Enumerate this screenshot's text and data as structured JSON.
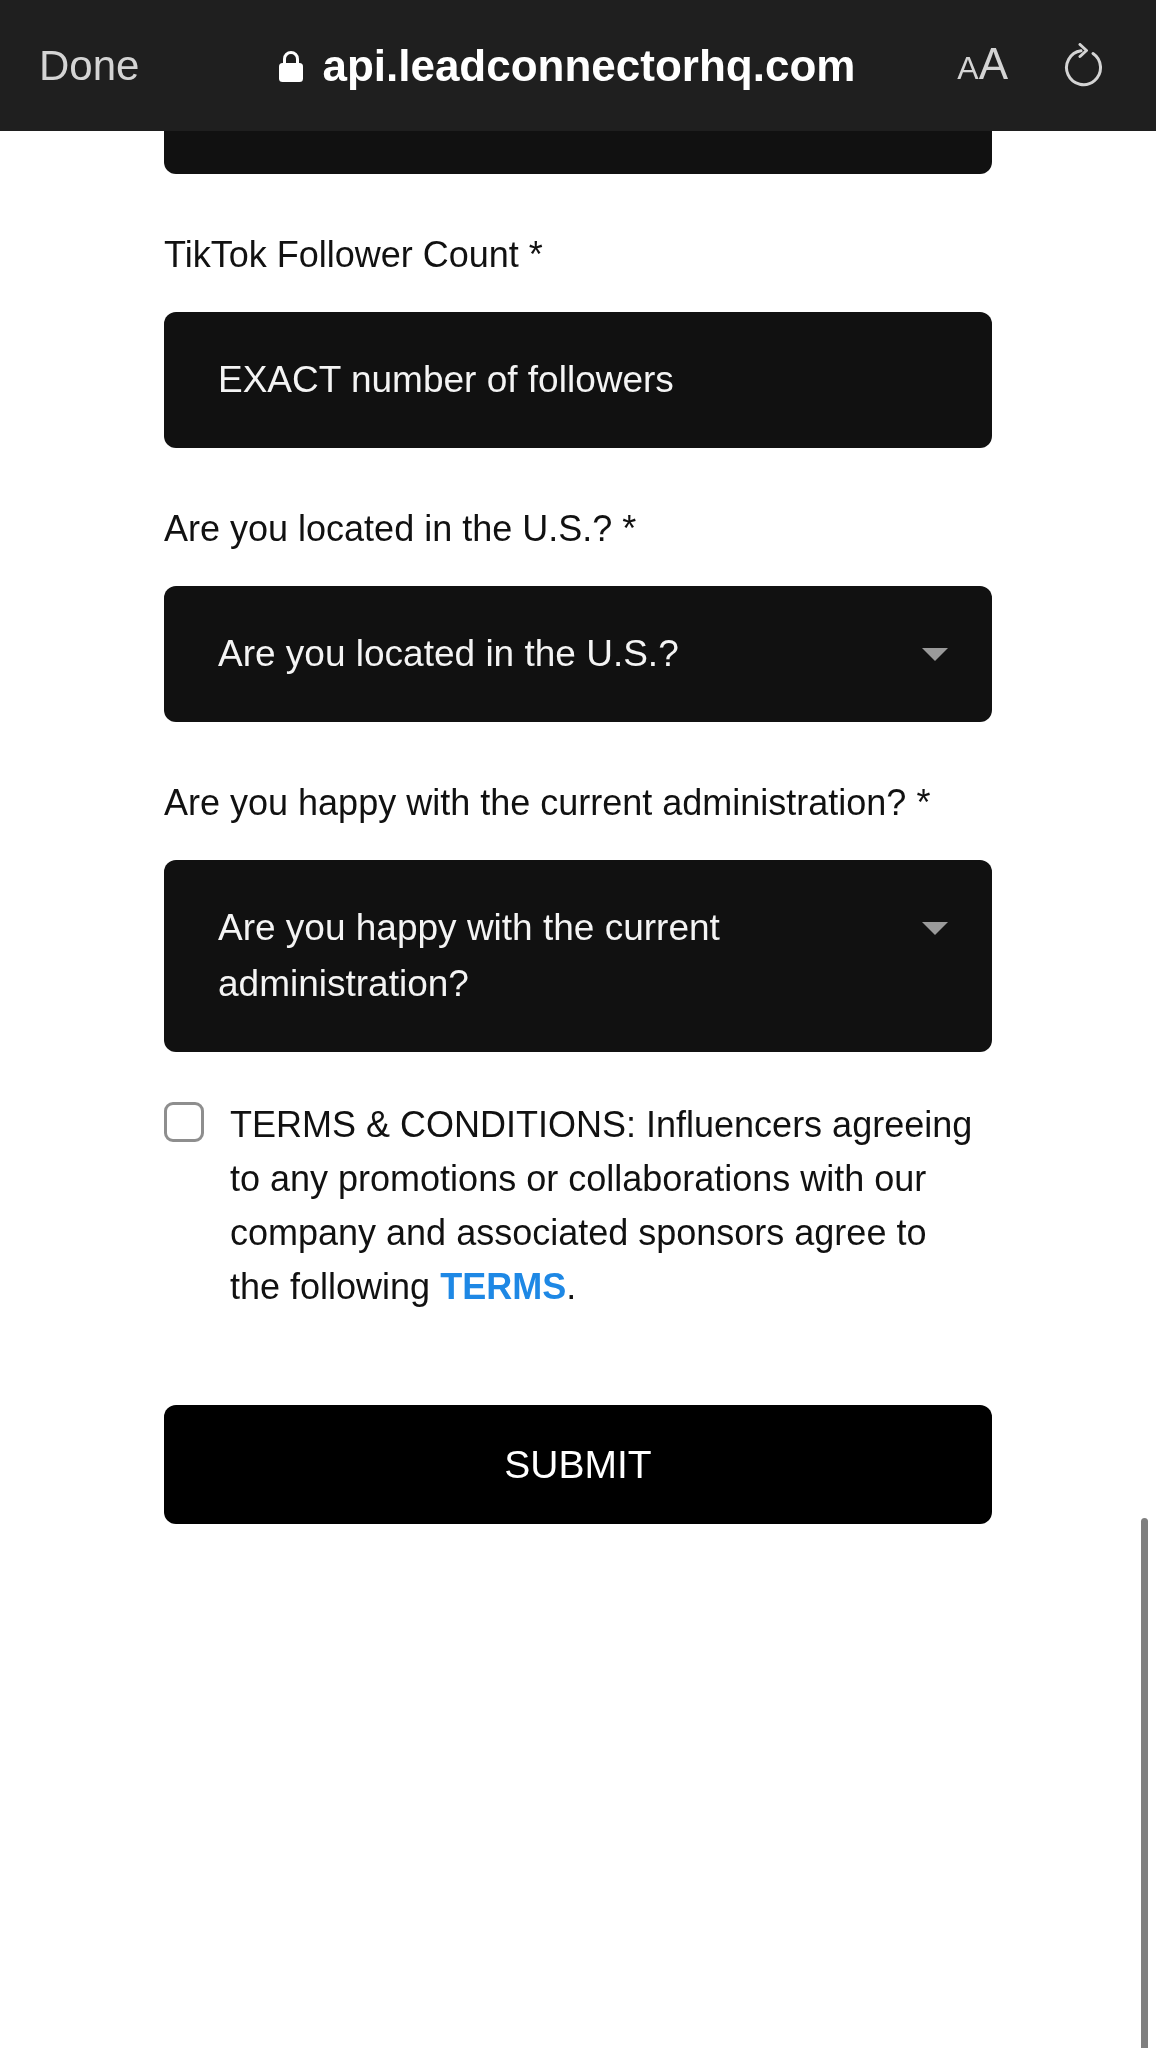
{
  "browser_bar": {
    "done_button": "Done",
    "url": "api.leadconnectorhq.com",
    "text_size_button": "AA"
  },
  "form": {
    "fields": [
      {
        "kind": "input",
        "clipped": true
      },
      {
        "kind": "input",
        "clipped": false,
        "label": "TikTok Follower Count *",
        "placeholder": "EXACT number of followers"
      },
      {
        "kind": "select",
        "clipped": false,
        "label": "Are you located in the U.S.? *",
        "placeholder": "Are you located in the U.S.?"
      },
      {
        "kind": "select",
        "clipped": false,
        "label": "Are you happy with the current administration? *",
        "placeholder": "Are you happy with the current administration?"
      }
    ],
    "terms": {
      "checked": false,
      "text": "TERMS & CONDITIONS: Influencers agreeing to any promotions or collaborations with our company and associated sponsors agree to the following ",
      "link": "TERMS",
      "text_after": "."
    },
    "submit_button": "SUBMIT"
  }
}
